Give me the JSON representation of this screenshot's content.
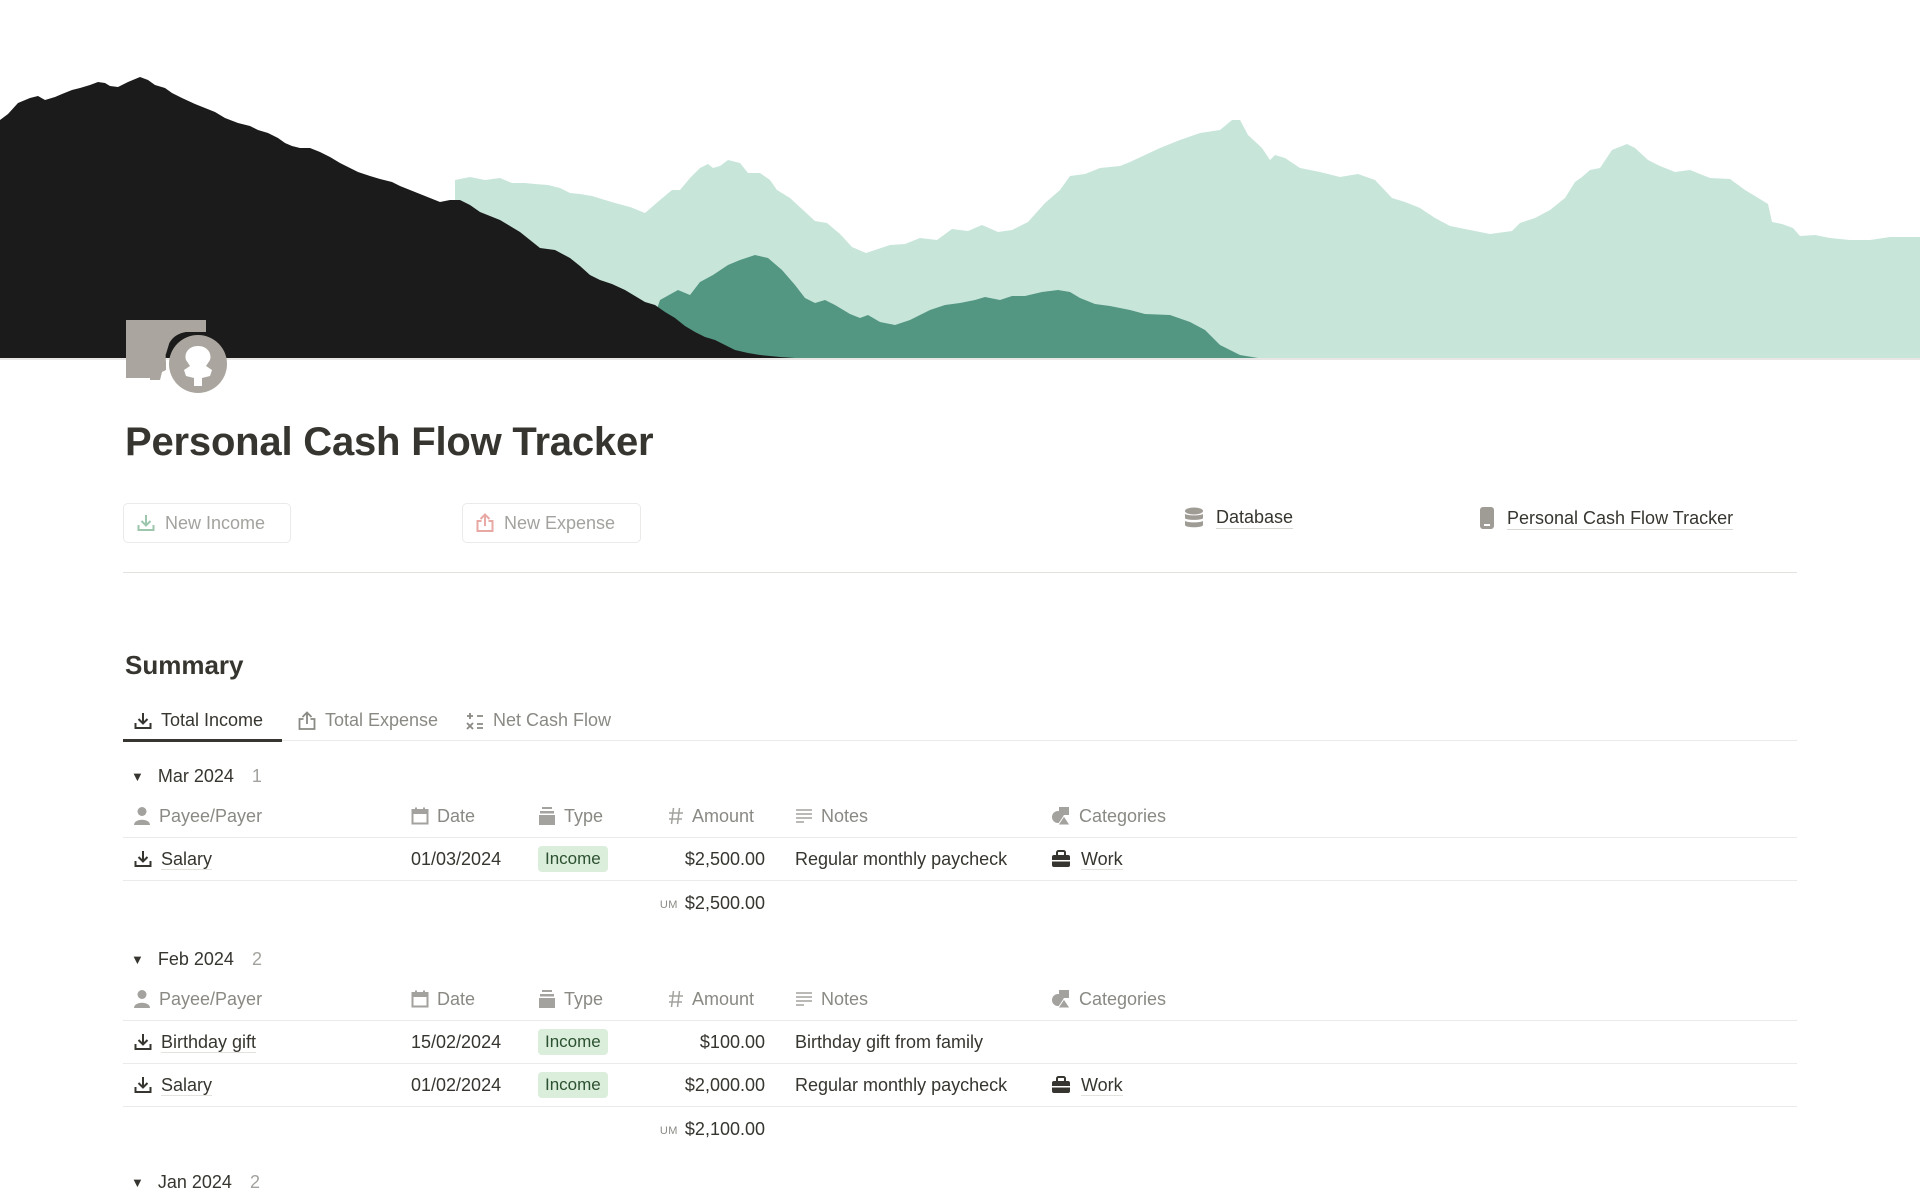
{
  "cover": {
    "colors": {
      "dark": "#1b1b1b",
      "light_green": "#c8e5da",
      "mid_green": "#539682"
    }
  },
  "page": {
    "icon": "cash-icon",
    "title": "Personal Cash Flow Tracker"
  },
  "actions": {
    "new_income": {
      "label": "New Income",
      "icon": "download-icon",
      "color": "#9cc7ac"
    },
    "new_expense": {
      "label": "New Expense",
      "icon": "upload-icon",
      "color": "#e8a8a4"
    }
  },
  "links": {
    "database": {
      "label": "Database",
      "icon": "database-icon"
    },
    "page": {
      "label": "Personal Cash Flow Tracker",
      "icon": "phone-icon"
    }
  },
  "summary": {
    "heading": "Summary",
    "tabs": [
      {
        "label": "Total Income",
        "icon": "download-icon",
        "active": true
      },
      {
        "label": "Total Expense",
        "icon": "upload-icon",
        "active": false
      },
      {
        "label": "Net Cash Flow",
        "icon": "calculator-icon",
        "active": false
      }
    ],
    "columns": {
      "name": "Payee/Payer",
      "date": "Date",
      "type": "Type",
      "amount": "Amount",
      "notes": "Notes",
      "categories": "Categories"
    },
    "sum_label": "SUM",
    "groups": [
      {
        "label": "Mar 2024",
        "count": "1",
        "rows": [
          {
            "name": "Salary",
            "date": "01/03/2024",
            "type": "Income",
            "amount": "$2,500.00",
            "notes": "Regular monthly paycheck",
            "category": "Work"
          }
        ],
        "sum": "$2,500.00"
      },
      {
        "label": "Feb 2024",
        "count": "2",
        "rows": [
          {
            "name": "Birthday gift",
            "date": "15/02/2024",
            "type": "Income",
            "amount": "$100.00",
            "notes": "Birthday gift from family",
            "category": ""
          },
          {
            "name": "Salary",
            "date": "01/02/2024",
            "type": "Income",
            "amount": "$2,000.00",
            "notes": "Regular monthly paycheck",
            "category": "Work"
          }
        ],
        "sum": "$2,100.00"
      },
      {
        "label": "Jan 2024",
        "count": "2",
        "rows": [],
        "sum": ""
      }
    ]
  }
}
